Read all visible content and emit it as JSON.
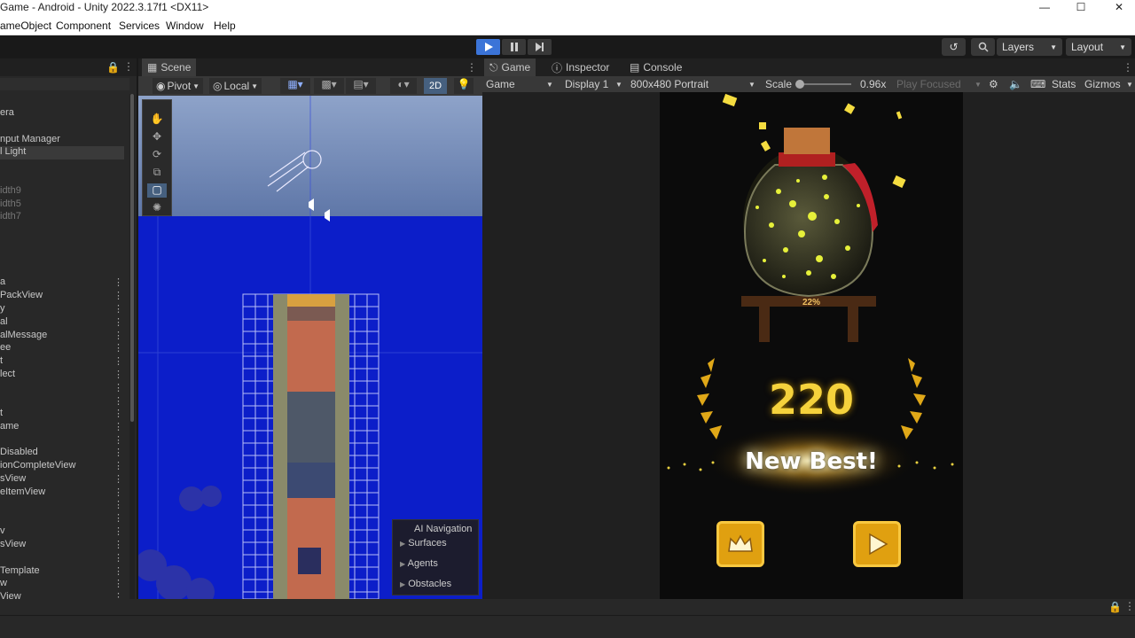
{
  "window": {
    "title": "Game - Android - Unity 2022.3.17f1 <DX11>"
  },
  "menu": [
    "ameObject",
    "Component",
    "Services",
    "Window",
    "Help"
  ],
  "toolbar": {
    "layers": "Layers",
    "layout": "Layout"
  },
  "hierarchy": {
    "items": [
      {
        "label": "era",
        "dim": false
      },
      {
        "label": "nput Manager",
        "dim": false
      },
      {
        "label": "l Light",
        "dim": false,
        "selected": true
      },
      {
        "label": "idth9",
        "dim": true
      },
      {
        "label": "idth5",
        "dim": true
      },
      {
        "label": "idth7",
        "dim": true
      },
      {
        "label": "a",
        "dim": false
      },
      {
        "label": "PackView",
        "dim": false
      },
      {
        "label": "y",
        "dim": false
      },
      {
        "label": "al",
        "dim": false
      },
      {
        "label": "alMessage",
        "dim": false
      },
      {
        "label": "ee",
        "dim": false
      },
      {
        "label": "t",
        "dim": false
      },
      {
        "label": "lect",
        "dim": false
      },
      {
        "label": "",
        "dim": false
      },
      {
        "label": "",
        "dim": false
      },
      {
        "label": "t",
        "dim": false
      },
      {
        "label": "ame",
        "dim": false
      },
      {
        "label": "",
        "dim": false
      },
      {
        "label": "Disabled",
        "dim": false
      },
      {
        "label": "ionCompleteView",
        "dim": false
      },
      {
        "label": "sView",
        "dim": false
      },
      {
        "label": "eItemView",
        "dim": false
      },
      {
        "label": "",
        "dim": false
      },
      {
        "label": "",
        "dim": false
      },
      {
        "label": "v",
        "dim": false
      },
      {
        "label": "sView",
        "dim": false
      },
      {
        "label": "",
        "dim": false
      },
      {
        "label": "Template",
        "dim": false
      },
      {
        "label": "w",
        "dim": false
      },
      {
        "label": "View",
        "dim": false
      }
    ]
  },
  "scene": {
    "tab": "Scene",
    "pivot": "Pivot",
    "local": "Local",
    "mode2d": "2D",
    "ai_navigation": {
      "title": "AI Navigation",
      "items": [
        "Surfaces",
        "Agents",
        "Obstacles"
      ]
    }
  },
  "game": {
    "tabs": [
      "Game",
      "Inspector",
      "Console"
    ],
    "mode": "Game",
    "display": "Display 1",
    "resolution": "800x480 Portrait",
    "scale_label": "Scale",
    "scale_value": "0.96x",
    "play_focused": "Play Focused",
    "stats": "Stats",
    "gizmos": "Gizmos",
    "progress_label": "22%",
    "progress": 0.22,
    "score": "220",
    "new_best": "New Best!"
  },
  "colors": {
    "play_accent": "#3b74d8",
    "water": "#0c1ec9",
    "gold": "#f5d23c"
  }
}
